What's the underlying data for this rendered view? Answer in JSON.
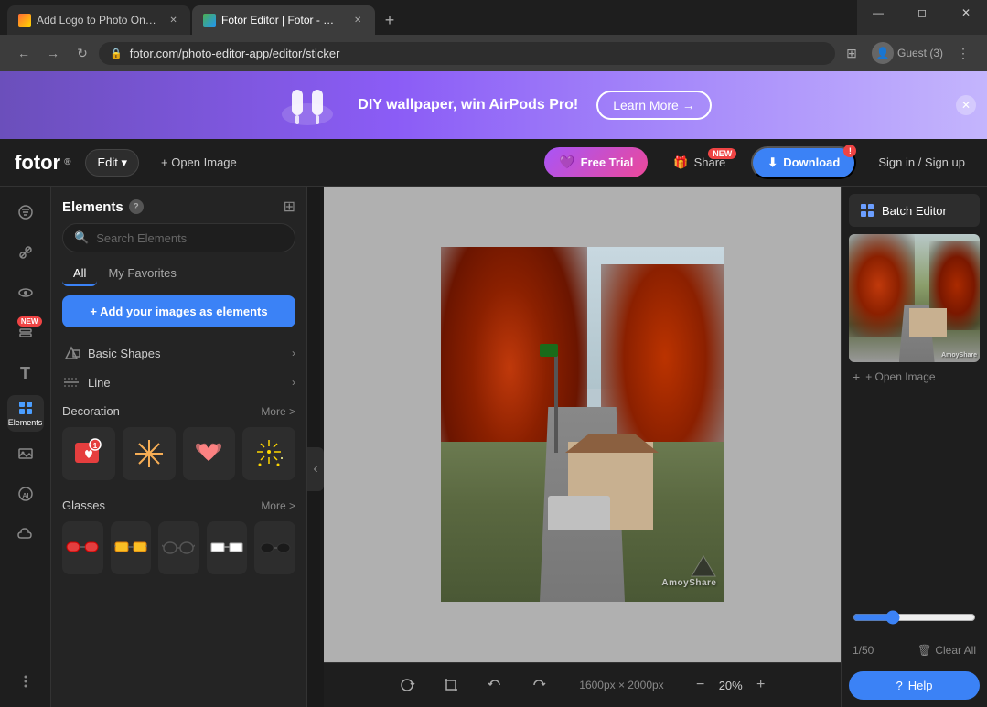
{
  "browser": {
    "tabs": [
      {
        "id": "tab1",
        "label": "Add Logo to Photo Online for...",
        "favicon": "add-logo",
        "active": false
      },
      {
        "id": "tab2",
        "label": "Fotor Editor | Fotor - Online...",
        "favicon": "fotor",
        "active": true
      }
    ],
    "address": "fotor.com/photo-editor-app/editor/sticker",
    "profile": "Guest (3)"
  },
  "banner": {
    "text": "DIY wallpaper, win AirPods Pro!",
    "learn_more_label": "Learn More →"
  },
  "header": {
    "logo": "fotor",
    "logo_sup": "®",
    "edit_label": "Edit ▾",
    "open_image_label": "+ Open Image",
    "free_trial_label": "Free Trial",
    "share_label": "Share",
    "share_badge": "NEW",
    "download_label": "Download",
    "sign_in_label": "Sign in / Sign up"
  },
  "sidebar": {
    "icons": [
      {
        "id": "filters",
        "symbol": "⊙",
        "label": ""
      },
      {
        "id": "retouch",
        "symbol": "◑",
        "label": ""
      },
      {
        "id": "eye",
        "symbol": "◉",
        "label": ""
      },
      {
        "id": "layers",
        "symbol": "▣",
        "label": "",
        "badge": "NEW"
      },
      {
        "id": "text",
        "symbol": "T",
        "label": ""
      },
      {
        "id": "elements",
        "symbol": "⊞",
        "label": "Elements",
        "active": true
      },
      {
        "id": "photos",
        "symbol": "▤",
        "label": ""
      },
      {
        "id": "ai",
        "symbol": "Ⓐ",
        "label": ""
      },
      {
        "id": "cloud",
        "symbol": "☁",
        "label": ""
      },
      {
        "id": "more",
        "symbol": "⊕",
        "label": ""
      }
    ]
  },
  "elements_panel": {
    "title": "Elements",
    "search_placeholder": "Search Elements",
    "tabs": [
      "All",
      "My Favorites"
    ],
    "active_tab": "All",
    "add_button_label": "+ Add your images as elements",
    "sections": [
      {
        "id": "basic-shapes",
        "icon": "⬡",
        "label": "Basic Shapes"
      },
      {
        "id": "line",
        "icon": "═",
        "label": "Line"
      }
    ],
    "decoration": {
      "title": "Decoration",
      "more_label": "More >",
      "items": [
        "❤️‍🔥",
        "✨",
        "💕",
        "🎆"
      ]
    },
    "glasses": {
      "title": "Glasses",
      "more_label": "More >",
      "items": [
        "🕶️",
        "😎",
        "👓",
        "🥽",
        "🕶️"
      ]
    }
  },
  "canvas": {
    "dims_label": "1600px × 2000px",
    "zoom_label": "20%",
    "watermark_line1": "▲",
    "watermark_line2": "AmoyShare"
  },
  "right_panel": {
    "batch_editor_label": "Batch Editor",
    "open_image_label": "+ Open Image",
    "page_info": "1/50",
    "clear_all_label": "Clear All",
    "help_label": "Help"
  }
}
